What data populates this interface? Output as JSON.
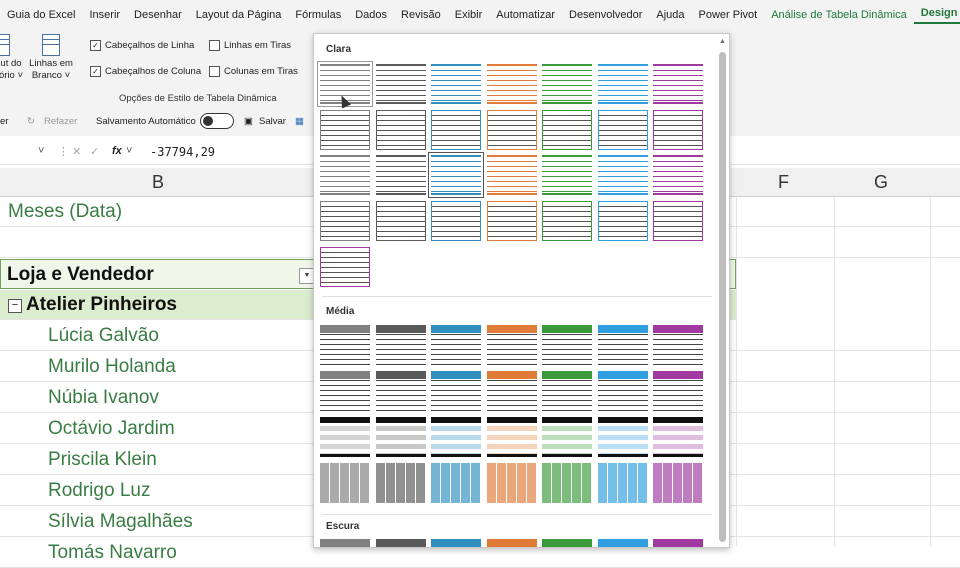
{
  "menu": {
    "items": [
      "Guia do Excel",
      "Inserir",
      "Desenhar",
      "Layout da Página",
      "Fórmulas",
      "Dados",
      "Revisão",
      "Exibir",
      "Automatizar",
      "Desenvolvedor",
      "Ajuda",
      "Power Pivot"
    ],
    "pivot_tab": "Análise de Tabela Dinâmica",
    "active_tab": "Design"
  },
  "ribbon": {
    "layout_label_1": "ut do",
    "layout_label_2": "ório ˅",
    "blank_rows_1": "Linhas em",
    "blank_rows_2": "Branco ˅",
    "row_headers": "Cabeçalhos de Linha",
    "col_headers": "Cabeçalhos de Coluna",
    "banded_rows": "Linhas em Tiras",
    "banded_cols": "Colunas em Tiras",
    "group_label": "Opções de Estilo de Tabela Dinâmica"
  },
  "qat": {
    "left_fragment": "er",
    "redo": "Refazer",
    "autosave": "Salvamento Automático",
    "save": "Salvar"
  },
  "formula": {
    "fx": "fx",
    "value": "-37794,29"
  },
  "columns": {
    "b": "B",
    "f": "F",
    "g": "G"
  },
  "sheet": {
    "meses": "Meses (Data)",
    "header": "Loja e Vendedor",
    "group": "Atelier Pinheiros",
    "vendors": [
      "Lúcia Galvão",
      "Murilo Holanda",
      "Núbia Ivanov",
      "Octávio Jardim",
      "Priscila Klein",
      "Rodrigo Luz",
      "Sílvia Magalhães",
      "Tomás Navarro"
    ]
  },
  "gallery": {
    "section_light": "Clara",
    "section_medium": "Média",
    "section_dark": "Escura",
    "palette": [
      "#808080",
      "#2f6fb5",
      "#e07b39",
      "#9a9a9a",
      "#e3a81b",
      "#4aa3df",
      "#6fb04a"
    ],
    "accents": [
      "#808080",
      "#5a5a5a",
      "#2f8fbf",
      "#e07b39",
      "#3a9a3a",
      "#2f9fdf",
      "#a03aa0"
    ]
  }
}
